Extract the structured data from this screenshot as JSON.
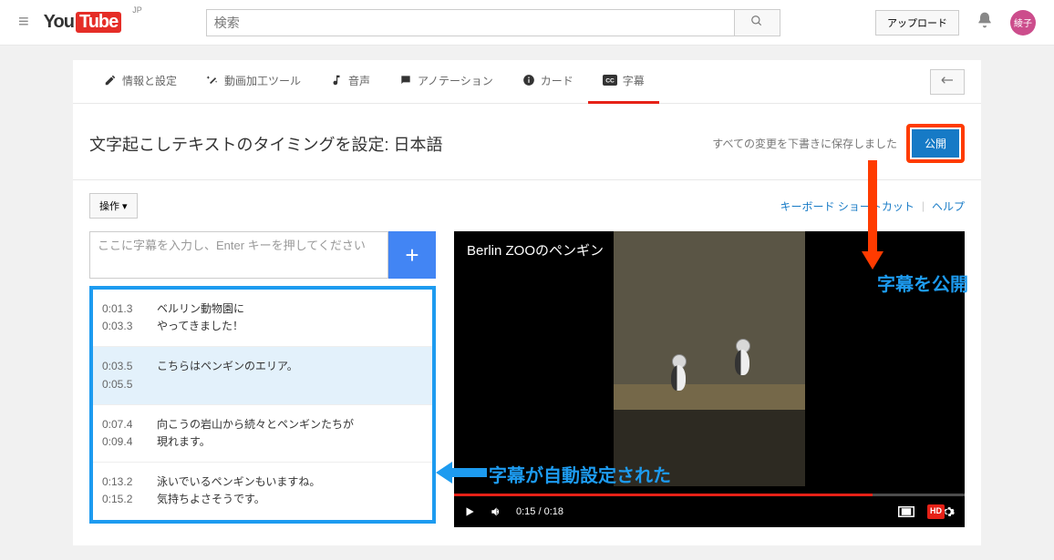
{
  "header": {
    "logo_you": "You",
    "logo_tube": "Tube",
    "region": "JP",
    "search_placeholder": "検索",
    "upload_label": "アップロード",
    "avatar_label": "綾子"
  },
  "tabs": {
    "info": "情報と設定",
    "enhance": "動画加工ツール",
    "audio": "音声",
    "annotations": "アノテーション",
    "cards": "カード",
    "subtitles": "字幕"
  },
  "page": {
    "title": "文字起こしテキストのタイミングを設定: 日本語",
    "save_status": "すべての変更を下書きに保存しました",
    "publish_label": "公開",
    "actions_label": "操作 ▾",
    "shortcut_label": "キーボード ショートカット",
    "help_label": "ヘルプ",
    "subtitle_placeholder": "ここに字幕を入力し、Enter キーを押してください"
  },
  "subtitles": [
    {
      "start": "0:01.3",
      "end": "0:03.3",
      "text": "ベルリン動物園に\nやってきました！"
    },
    {
      "start": "0:03.5",
      "end": "0:05.5",
      "text": "こちらはペンギンのエリア。"
    },
    {
      "start": "0:07.4",
      "end": "0:09.4",
      "text": "向こうの岩山から続々とペンギンたちが\n現れます。"
    },
    {
      "start": "0:13.2",
      "end": "0:15.2",
      "text": "泳いでいるペンギンもいますね。\n気持ちよさそうです。"
    }
  ],
  "video": {
    "overlay_title": "Berlin ZOOのペンギン",
    "time_display": "0:15 / 0:18"
  },
  "annotations": {
    "publish_callout": "字幕を公開",
    "auto_callout": "字幕が自動設定された"
  }
}
